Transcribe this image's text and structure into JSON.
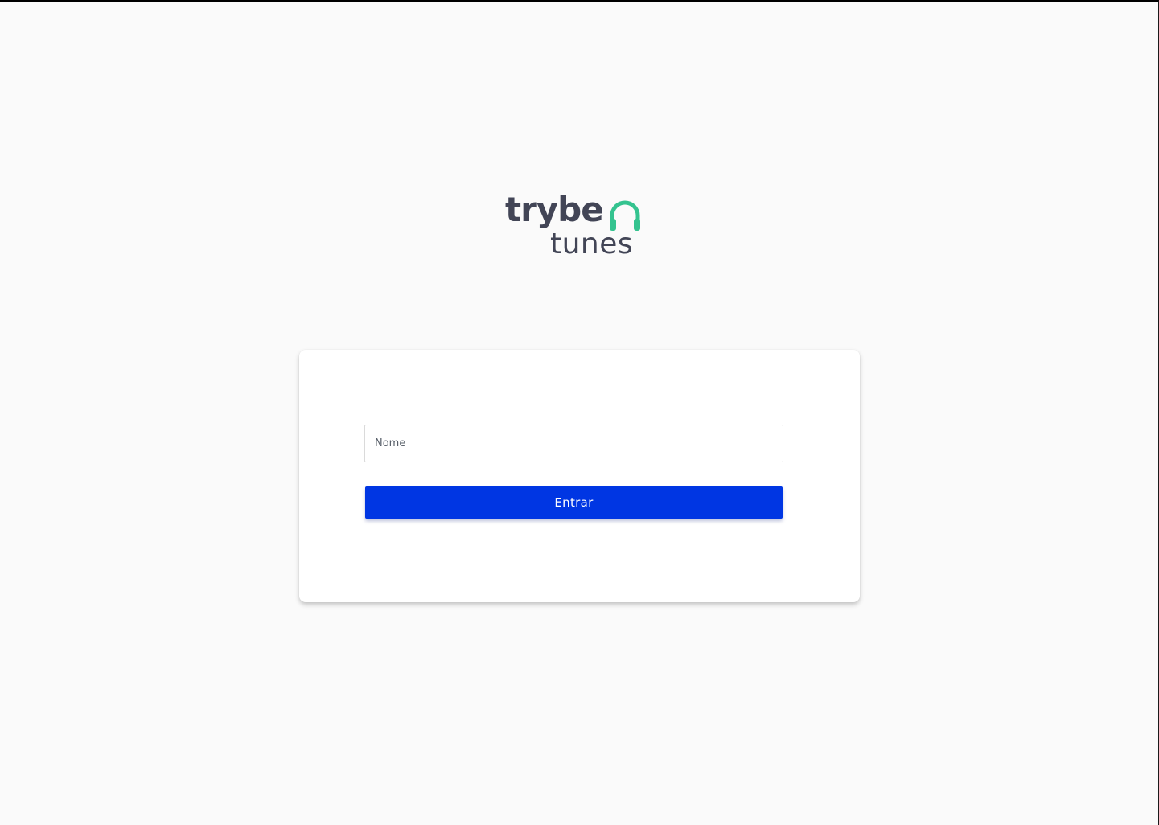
{
  "logo": {
    "line1": "trybe",
    "line2": "tunes",
    "icon": "headphones-icon",
    "text_color": "#424556",
    "icon_color": "#34c38f"
  },
  "login": {
    "name_placeholder": "Nome",
    "name_value": "",
    "submit_label": "Entrar"
  },
  "colors": {
    "background": "#fafafa",
    "card": "#ffffff",
    "primary": "#0036e3"
  }
}
